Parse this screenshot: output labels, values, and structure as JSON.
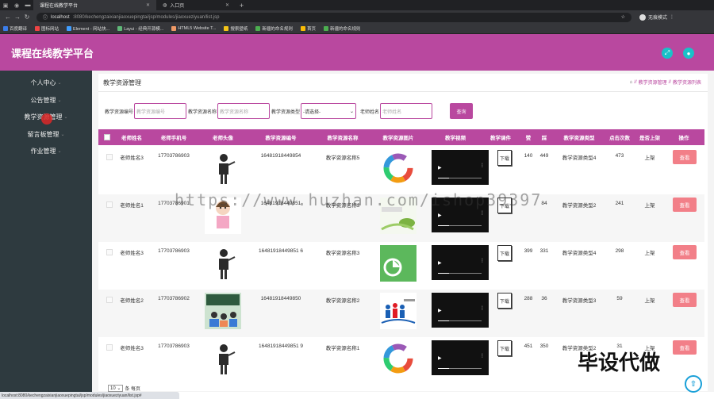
{
  "browser": {
    "tabs": [
      {
        "label": "课程在线教学平台",
        "active": true
      },
      {
        "label": "入口页",
        "active": false
      }
    ],
    "url_host": "localhost",
    "url_path": ":8080/kechengzaixianjiaoxuepingtai/jsp/modules/jiaoxueziyuan/list.jsp",
    "profile_label": "无痕模式",
    "bookmarks": [
      "百度翻译",
      "图标网站",
      "Element - 网站快...",
      "Layui - 经典开源模...",
      "HTML5 Website T...",
      "搜索壁纸",
      "新疆的命名规则",
      "首页",
      "新疆的命名规则"
    ],
    "status_url": "localhost:8080/kechengzaixianjiaoxuepingtai/jsp/modules/jiaoxueziyuan/list.jsp#"
  },
  "app": {
    "title": "课程在线教学平台",
    "colors": {
      "accent": "#b9489f",
      "sidebar": "#2e3a3f",
      "header_button": "#19c2c8",
      "view_button": "#f27f88"
    }
  },
  "sidebar": {
    "items": [
      {
        "label": "个人中心"
      },
      {
        "label": "公告管理"
      },
      {
        "label": "教学资源管理"
      },
      {
        "label": "留言板管理"
      },
      {
        "label": "作业管理"
      }
    ]
  },
  "page": {
    "title": "教学资源管理",
    "breadcrumb": [
      "教学资源管理",
      "教学资源列表"
    ]
  },
  "search": {
    "code_label": "教学资源编号",
    "code_placeholder": "教学资源编号",
    "name_label": "教学资源名称",
    "name_placeholder": "教学资源名称",
    "type_label": "教学资源类型",
    "type_value": "-请选择-",
    "teacher_label": "老师姓名",
    "teacher_placeholder": "老师姓名",
    "button": "查询"
  },
  "table": {
    "headers": [
      "老师姓名",
      "老师手机号",
      "老师头像",
      "教学资源编号",
      "教学资源名称",
      "教学资源图片",
      "教学视频",
      "教学课件",
      "赞",
      "踩",
      "教学资源类型",
      "点击次数",
      "是否上架",
      "操作"
    ],
    "download_label": "下载",
    "view_label": "查看",
    "rows": [
      {
        "teacher": "老师姓名3",
        "phone": "17703786903",
        "code": "16481918449854",
        "name": "教学资源名称5",
        "like": "140",
        "dislike": "449",
        "type": "教学资源类型4",
        "clicks": "473",
        "status": "上架",
        "image": "ring"
      },
      {
        "teacher": "老师姓名1",
        "phone": "17703786901",
        "code": "16481918449851",
        "name": "教学资源名称3",
        "like": "",
        "dislike": "84",
        "type": "教学资源类型2",
        "clicks": "241",
        "status": "上架",
        "image": "leaf"
      },
      {
        "teacher": "老师姓名3",
        "phone": "17703786903",
        "code": "16481918449851 6",
        "name": "教学资源名称3",
        "like": "399",
        "dislike": "331",
        "type": "教学资源类型4",
        "clicks": "298",
        "status": "上架",
        "image": "green"
      },
      {
        "teacher": "老师姓名2",
        "phone": "17703786902",
        "code": "16481918449850",
        "name": "教学资源名称2",
        "like": "288",
        "dislike": "36",
        "type": "教学资源类型3",
        "clicks": "59",
        "status": "上架",
        "image": "people"
      },
      {
        "teacher": "老师姓名3",
        "phone": "17703786903",
        "code": "16481918449851 9",
        "name": "教学资源名称1",
        "like": "451",
        "dislike": "350",
        "type": "教学资源类型2",
        "clicks": "31",
        "status": "上架",
        "image": "ring"
      }
    ]
  },
  "pager": {
    "page_size": "10",
    "per_page_label": "条 每页"
  },
  "overlay": {
    "watermark": "https://www.huzhan.com/ishop39397",
    "badge": "毕设代做"
  }
}
